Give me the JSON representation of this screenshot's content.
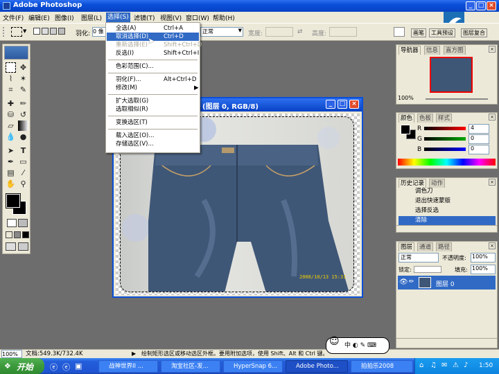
{
  "app": {
    "title": "Adobe Photoshop"
  },
  "menubar": [
    "文件(F)",
    "编辑(E)",
    "图像(I)",
    "图层(L)",
    "选择(S)",
    "滤镜(T)",
    "视图(V)",
    "窗口(W)",
    "帮助(H)"
  ],
  "options": {
    "feather_label": "羽化:",
    "feather_value": "0 像",
    "style_value": "正常",
    "width_label": "宽度:",
    "height_label": "高度:",
    "palette_tabs": [
      "画笔",
      "工具预设",
      "图层复合"
    ]
  },
  "select_menu": [
    {
      "label": "全选(A)",
      "shortcut": "Ctrl+A",
      "state": "normal"
    },
    {
      "label": "取消选择(D)",
      "shortcut": "Ctrl+D",
      "state": "highlight"
    },
    {
      "label": "重新选择(E)",
      "shortcut": "Shift+Ctrl+D",
      "state": "disabled"
    },
    {
      "label": "反选(I)",
      "shortcut": "Shift+Ctrl+I",
      "state": "normal"
    },
    {
      "sep": true
    },
    {
      "label": "色彩范围(C)...",
      "shortcut": "",
      "state": "normal"
    },
    {
      "sep": true
    },
    {
      "label": "羽化(F)...",
      "shortcut": "Alt+Ctrl+D",
      "state": "normal"
    },
    {
      "label": "修改(M)",
      "shortcut": "▶",
      "state": "normal"
    },
    {
      "sep": true
    },
    {
      "label": "扩大选取(G)",
      "shortcut": "",
      "state": "normal"
    },
    {
      "label": "选取相似(R)",
      "shortcut": "",
      "state": "normal"
    },
    {
      "sep": true
    },
    {
      "label": "变换选区(T)",
      "shortcut": "",
      "state": "normal"
    },
    {
      "sep": true
    },
    {
      "label": "载入选区(O)...",
      "shortcut": "",
      "state": "normal"
    },
    {
      "label": "存储选区(V)...",
      "shortcut": "",
      "state": "normal"
    }
  ],
  "document": {
    "title": "(图层 0, RGB/8)",
    "photo_date": "2008/10/13 15:31"
  },
  "navigator": {
    "tabs": [
      "导航器",
      "信息",
      "直方图"
    ],
    "zoom": "100%"
  },
  "color": {
    "tabs": [
      "颜色",
      "色板",
      "样式"
    ],
    "r_label": "R",
    "g_label": "G",
    "b_label": "B",
    "r": "4",
    "g": "0",
    "b": "0"
  },
  "history": {
    "tabs": [
      "历史记录",
      "动作"
    ],
    "items": [
      "调色刀",
      "退出快速蒙版",
      "选择反选",
      "清除"
    ]
  },
  "layers": {
    "tabs": [
      "图层",
      "通道",
      "路径"
    ],
    "mode": "正常",
    "opacity_label": "不透明度:",
    "opacity": "100%",
    "lock_label": "锁定:",
    "fill_label": "填充:",
    "fill": "100%",
    "layer_name": "图层 0"
  },
  "status": {
    "zoom": "100%",
    "doc": "文档:549.3K/732.4K",
    "hint": "绘制矩形选区或移动选区外框。要用附加选项，使用 Shift、Alt 和 Ctrl 键。"
  },
  "taskbar": {
    "start": "开始",
    "buttons": [
      "战神世界II ...",
      "淘宝社区-发...",
      "HyperSnap 6...",
      "Adobe Photo...",
      "拍拍乐2008"
    ],
    "time": "1:50",
    "ime": "中"
  }
}
